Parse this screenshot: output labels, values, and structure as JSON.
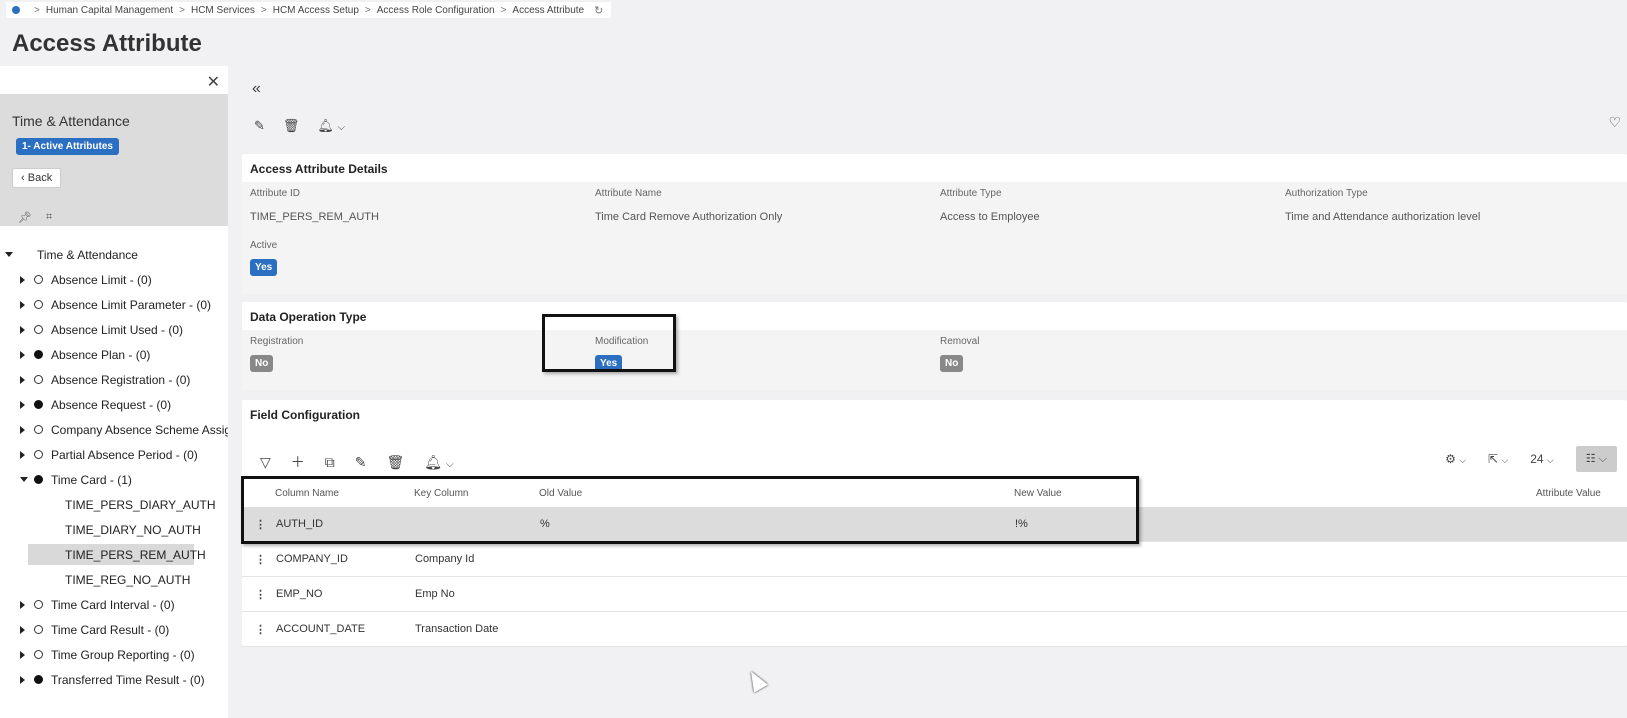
{
  "breadcrumb": {
    "items": [
      "Human Capital Management",
      "HCM Services",
      "HCM Access Setup",
      "Access Role Configuration",
      "Access Attribute"
    ]
  },
  "page_title": "Access Attribute",
  "left_panel": {
    "header_title": "Time & Attendance",
    "badge": "1- Active Attributes",
    "back_label": "Back",
    "tree": {
      "root": "Time & Attendance",
      "items": [
        {
          "label": "Absence Limit - (0)",
          "filled": false
        },
        {
          "label": "Absence Limit Parameter - (0)",
          "filled": false
        },
        {
          "label": "Absence Limit Used - (0)",
          "filled": false
        },
        {
          "label": "Absence Plan - (0)",
          "filled": true
        },
        {
          "label": "Absence Registration - (0)",
          "filled": false
        },
        {
          "label": "Absence Request - (0)",
          "filled": true
        },
        {
          "label": "Company Absence Scheme Assig",
          "filled": false
        },
        {
          "label": "Partial Absence Period - (0)",
          "filled": false
        },
        {
          "label": "Time Card - (1)",
          "filled": true
        },
        {
          "label": "Time Card Interval - (0)",
          "filled": false
        },
        {
          "label": "Time Card Result - (0)",
          "filled": false
        },
        {
          "label": "Time Group Reporting - (0)",
          "filled": false
        },
        {
          "label": "Transferred Time Result - (0)",
          "filled": true
        }
      ],
      "time_card_children": [
        "TIME_PERS_DIARY_AUTH",
        "TIME_DIARY_NO_AUTH",
        "TIME_PERS_REM_AUTH",
        "TIME_REG_NO_AUTH"
      ]
    }
  },
  "details": {
    "title": "Access Attribute Details",
    "attribute_id_label": "Attribute ID",
    "attribute_id": "TIME_PERS_REM_AUTH",
    "attribute_name_label": "Attribute Name",
    "attribute_name": "Time Card Remove Authorization Only",
    "attribute_type_label": "Attribute Type",
    "attribute_type": "Access to Employee",
    "authorization_type_label": "Authorization Type",
    "authorization_type": "Time and Attendance authorization level",
    "active_label": "Active",
    "active": "Yes"
  },
  "data_operation": {
    "title": "Data Operation Type",
    "registration_label": "Registration",
    "registration": "No",
    "modification_label": "Modification",
    "modification": "Yes",
    "removal_label": "Removal",
    "removal": "No"
  },
  "field_config": {
    "title": "Field Configuration",
    "page_size": "24",
    "columns": [
      "Column Name",
      "Key Column",
      "Old Value",
      "New Value",
      "Attribute Value"
    ],
    "rows": [
      {
        "column_name": "AUTH_ID",
        "key_column": "",
        "old_value": "%",
        "new_value": "!%"
      },
      {
        "column_name": "COMPANY_ID",
        "key_column": "Company Id",
        "old_value": "",
        "new_value": ""
      },
      {
        "column_name": "EMP_NO",
        "key_column": "Emp No",
        "old_value": "",
        "new_value": ""
      },
      {
        "column_name": "ACCOUNT_DATE",
        "key_column": "Transaction Date",
        "old_value": "",
        "new_value": ""
      }
    ]
  }
}
